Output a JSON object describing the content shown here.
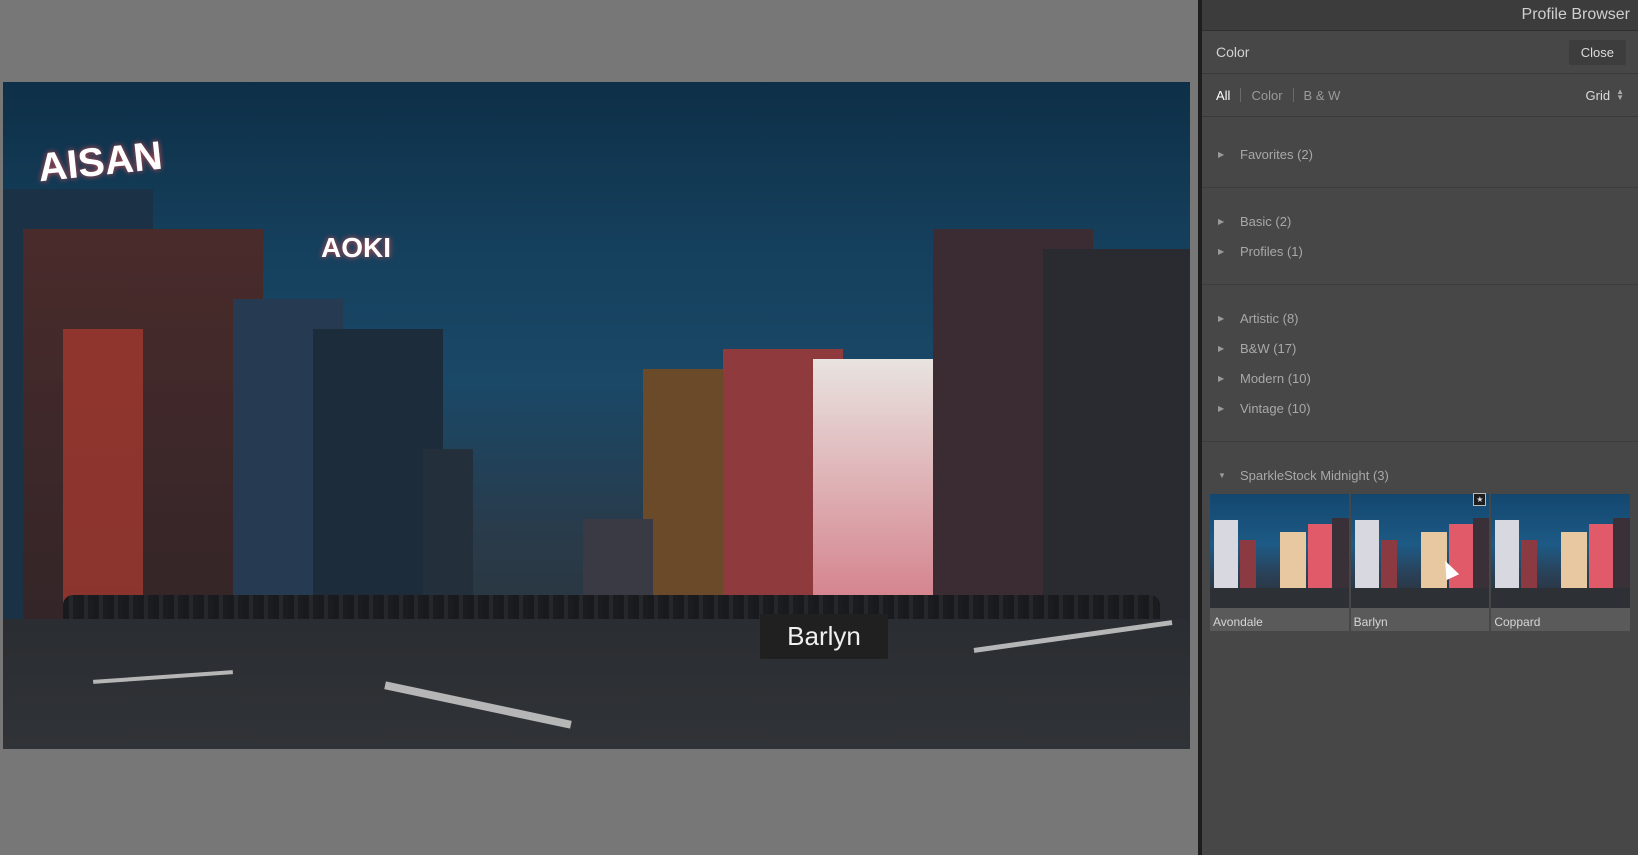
{
  "panel": {
    "title": "Profile Browser",
    "group_label": "Color",
    "close_label": "Close",
    "filters": [
      "All",
      "Color",
      "B & W"
    ],
    "active_filter": "All",
    "view_mode": "Grid"
  },
  "groups": [
    {
      "label": "Favorites (2)",
      "expanded": false
    },
    {
      "label": "Basic (2)",
      "expanded": false
    },
    {
      "label": "Profiles (1)",
      "expanded": false
    },
    {
      "label": "Artistic (8)",
      "expanded": false
    },
    {
      "label": "B&W (17)",
      "expanded": false
    },
    {
      "label": "Modern (10)",
      "expanded": false
    },
    {
      "label": "Vintage (10)",
      "expanded": false
    },
    {
      "label": "SparkleStock Midnight (3)",
      "expanded": true
    }
  ],
  "profiles": [
    {
      "label": "Avondale"
    },
    {
      "label": "Barlyn"
    },
    {
      "label": "Coppard"
    }
  ],
  "preview": {
    "caption": "Barlyn",
    "signs": [
      "AISAN",
      "AOKI"
    ]
  },
  "icons": {
    "collapsed": "triangle-right-icon",
    "expanded": "triangle-down-icon",
    "favorite": "star-icon"
  },
  "colors": {
    "panel_bg": "#474747",
    "active_filter": "#ffffff",
    "caption_bg": "#202020"
  }
}
